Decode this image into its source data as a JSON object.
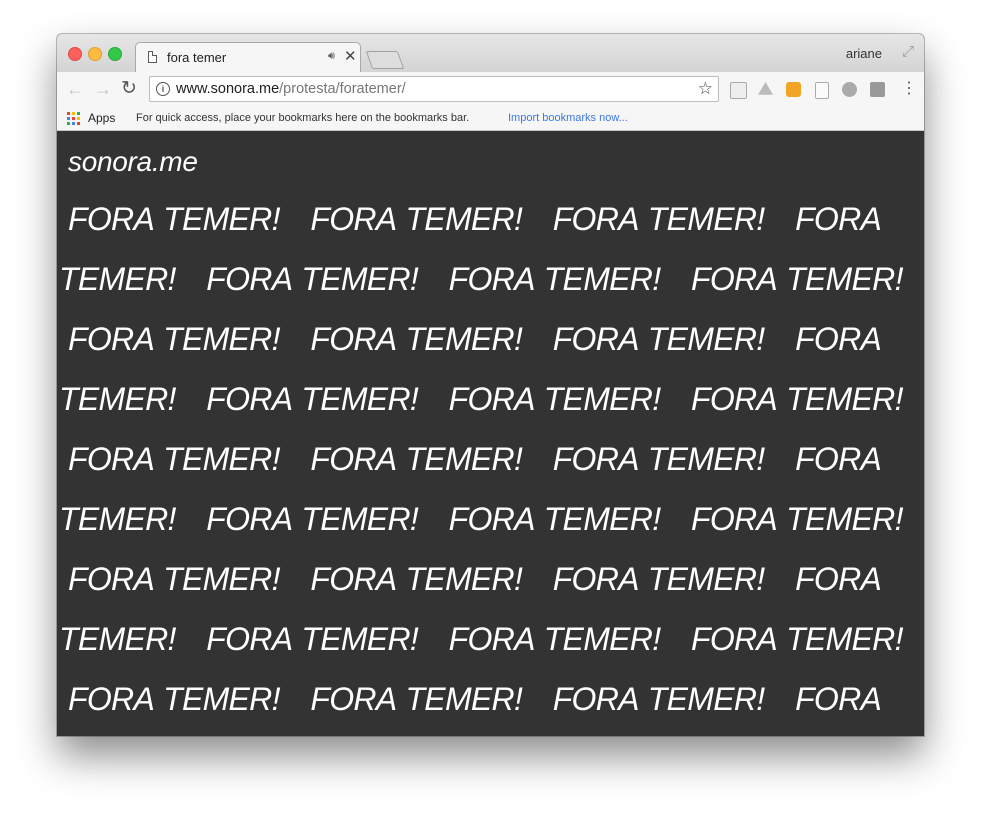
{
  "browser": {
    "tab_title": "fora temer",
    "tab_audio_icon": "speaker-icon",
    "tab_close": "✕",
    "profile_name": "ariane",
    "url_host": "www.sonora.me",
    "url_path": "/protesta/foratemer/"
  },
  "bookmarks_bar": {
    "apps_label": "Apps",
    "hint": "For quick access, place your bookmarks here on the bookmarks bar.",
    "import_link": "Import bookmarks now..."
  },
  "page": {
    "site_title": "sonora.me",
    "lines": [
      "FORA TEMER!   FORA TEMER!   FORA TEMER!   FORA",
      "TEMER!   FORA TEMER!   FORA TEMER!   FORA TEMER!",
      "FORA TEMER!   FORA TEMER!   FORA TEMER!   FORA",
      "TEMER!   FORA TEMER!   FORA TEMER!   FORA TEMER!",
      "FORA TEMER!   FORA TEMER!   FORA TEMER!   FORA",
      "TEMER!   FORA TEMER!   FORA TEMER!   FORA TEMER!",
      "FORA TEMER!   FORA TEMER!   FORA TEMER!   FORA",
      "TEMER!   FORA TEMER!   FORA TEMER!   FORA TEMER!",
      "FORA TEMER!   FORA TEMER!   FORA TEMER!   FORA"
    ]
  },
  "colors": {
    "page_background": "#333333",
    "text": "#ffffff",
    "link": "#3b78e7"
  }
}
